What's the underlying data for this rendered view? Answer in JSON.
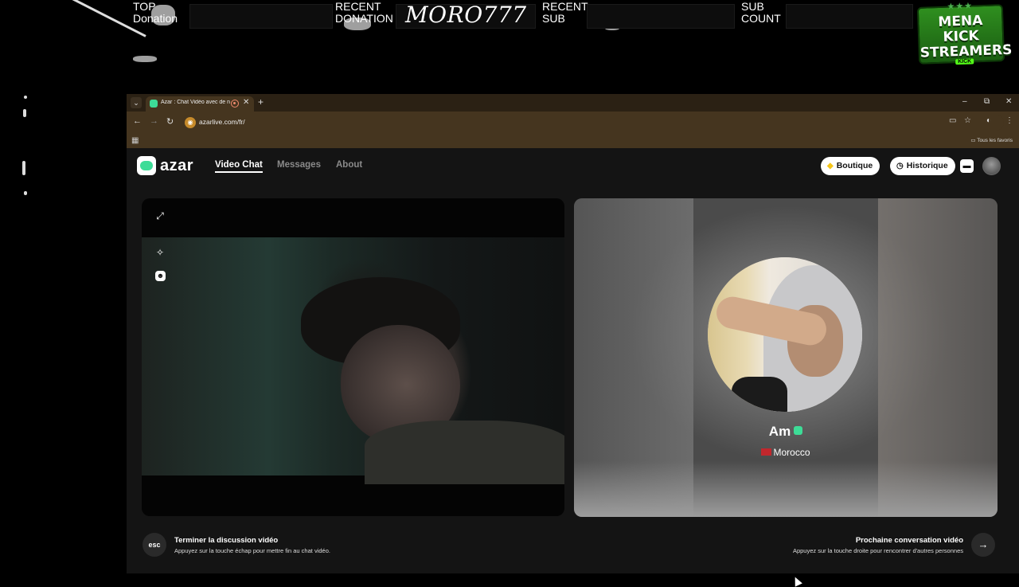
{
  "overlay": {
    "top_label": "TOP",
    "top_sub": "Donation",
    "recent_donation_l1": "RECENT",
    "recent_donation_l2": "DONATION",
    "donor_name": "MORO777",
    "recent_sub_l1": "RECENT",
    "recent_sub_l2": "SUB",
    "sub_count_l1": "SUB",
    "sub_count_l2": "COUNT",
    "logo_line1": "MENA KICK",
    "logo_line2": "STREAMERS",
    "logo_badge": "KICK",
    "logo_stars": "★★★"
  },
  "browser": {
    "tab_title": "Azar : Chat Vidéo avec de n",
    "url": "azarlive.com/fr/",
    "bookmarks_folder": "Tous les favoris",
    "icons": [
      "back-icon",
      "forward-icon",
      "reload-icon",
      "cast-icon",
      "star-icon",
      "extension-icon",
      "menu-icon"
    ]
  },
  "azar": {
    "brand": "azar",
    "nav": [
      "Video Chat",
      "Messages",
      "About"
    ],
    "active_nav": "Video Chat",
    "boutique": "Boutique",
    "historique": "Historique",
    "peer": {
      "name": "Am",
      "country": "Morocco"
    },
    "footer": {
      "left_key": "esc",
      "left_title": "Terminer la discussion vidéo",
      "left_sub": "Appuyez sur la touche échap pour mettre fin au chat vidéo.",
      "right_title": "Prochaine conversation vidéo",
      "right_sub": "Appuyez sur la touche droite pour rencontrer d'autres personnes",
      "right_key": "→"
    }
  },
  "colors": {
    "accent": "#3ddc97",
    "browser_frame": "#45351f",
    "page_bg": "#141414"
  }
}
